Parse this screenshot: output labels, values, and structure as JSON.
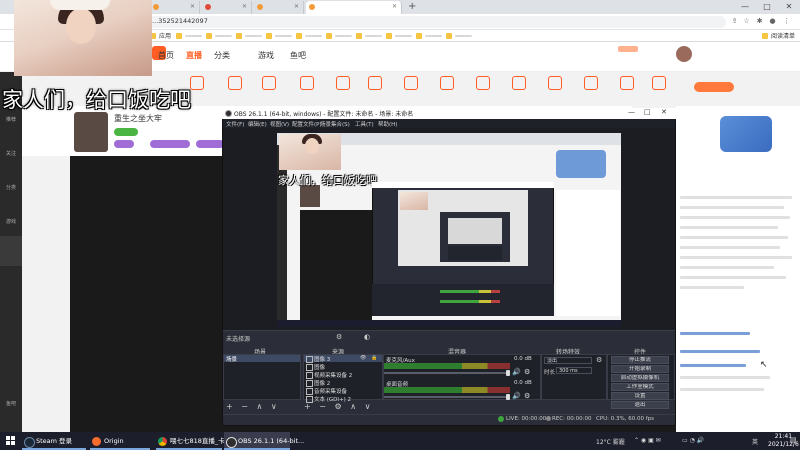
{
  "browser": {
    "address": "...352521442097",
    "bookmark_apps": "应用",
    "bookmark_read_list": "阅读清单"
  },
  "douyu": {
    "nav": [
      {
        "label": "首页",
        "active": false
      },
      {
        "label": "直播",
        "active": true
      },
      {
        "label": "分类",
        "active": false
      },
      {
        "label": "游戏",
        "active": false
      },
      {
        "label": "鱼吧",
        "active": false
      }
    ],
    "sidebar": [
      "推荐",
      "关注",
      "分类",
      "游戏",
      "鱼吧"
    ],
    "streamer_name": "重生之坐大牢",
    "colors": {
      "accent": "#ff5d23",
      "tag_purple": "#a06cd5"
    }
  },
  "overlay": {
    "caption": "家人们，给口饭吃吧"
  },
  "obs": {
    "title": "OBS 26.1.1 (64-bit, windows) - 配置文件: 未命名 - 场景: 未命名",
    "menu": [
      "文件(F)",
      "编辑(E)",
      "视图(V)",
      "配置文件(P)",
      "场景集合(S)",
      "工具(T)",
      "帮助(H)"
    ],
    "docks": {
      "scenes": "场景",
      "sources": "来源",
      "mixer": "混音器",
      "transitions": "转场特效",
      "controls": "控件"
    },
    "no_source_selected": "未选择源",
    "scene_item": "场景",
    "sources_list": [
      {
        "label": "图像 3",
        "selected": true
      },
      {
        "label": "图像",
        "selected": false
      },
      {
        "label": "视频采集设备 2",
        "selected": false
      },
      {
        "label": "图像 2",
        "selected": false
      },
      {
        "label": "音频采集设备",
        "selected": false
      },
      {
        "label": "文本 (GDI+) 2",
        "selected": false
      }
    ],
    "mixer_tracks": [
      {
        "label": "麦克风/Aux",
        "level_db": "0.0 dB"
      },
      {
        "label": "桌面音频",
        "level_db": "0.0 dB"
      }
    ],
    "transition": {
      "type": "淡出",
      "duration_label": "时长",
      "duration": "300 ms"
    },
    "controls": [
      "停止推流",
      "开始录制",
      "启动虚拟摄像机",
      "工作室模式",
      "设置",
      "退出"
    ],
    "status": {
      "live": "LIVE: 00:00:00",
      "rec": "REC: 00:00:00",
      "cpu": "CPU: 0.3%, 60.00 fps"
    }
  },
  "taskbar": {
    "tasks": [
      {
        "label": "Steam 登录",
        "kind": "steam"
      },
      {
        "label": "Origin",
        "kind": "origin"
      },
      {
        "label": "喂七七818直播_卡...",
        "kind": "chrome"
      },
      {
        "label": "OBS 26.1.1 (64-bit...",
        "kind": "obs"
      }
    ],
    "weather": "12°C 雾霾",
    "language": "英",
    "time": "21:41",
    "date": "2021/12/6"
  }
}
